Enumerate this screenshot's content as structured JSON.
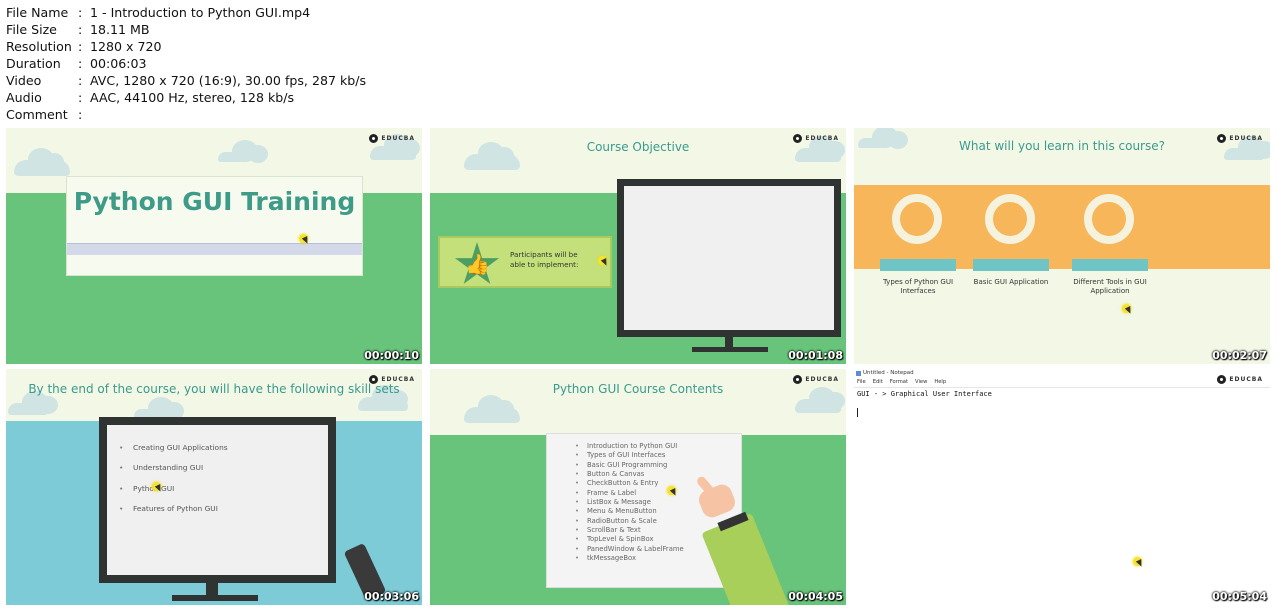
{
  "file_info": [
    {
      "key": "File Name",
      "value": "1 - Introduction to Python GUI.mp4"
    },
    {
      "key": "File Size",
      "value": "18.11 MB"
    },
    {
      "key": "Resolution",
      "value": "1280 x 720"
    },
    {
      "key": "Duration",
      "value": "00:06:03"
    },
    {
      "key": "Video",
      "value": "AVC, 1280 x 720 (16:9), 30.00 fps, 287 kb/s"
    },
    {
      "key": "Audio",
      "value": "AAC, 44100 Hz, stereo, 128 kb/s"
    },
    {
      "key": "Comment",
      "value": ""
    }
  ],
  "separator": ":",
  "logo_text": "EDUCBA",
  "thumbs": [
    {
      "timestamp": "00:00:10",
      "title": "Python GUI Training"
    },
    {
      "timestamp": "00:01:08",
      "title": "Course Objective",
      "banner": "Participants will be able to implement:"
    },
    {
      "timestamp": "00:02:07",
      "title": "What will you learn in this course?",
      "items": [
        "Types of Python GUI Interfaces",
        "Basic GUI Application",
        "Different Tools in GUI Application"
      ]
    },
    {
      "timestamp": "00:03:06",
      "title": "By the end of the course, you will have the following skill sets",
      "items": [
        "Creating GUI Applications",
        "Understanding GUI",
        "Python GUI",
        "Features of Python GUI"
      ]
    },
    {
      "timestamp": "00:04:05",
      "title": "Python GUI Course Contents",
      "items": [
        "Introduction to Python GUI",
        "Types of GUI Interfaces",
        "Basic GUI Programming",
        "Button & Canvas",
        "CheckButton & Entry",
        "Frame & Label",
        "ListBox & Message",
        "Menu & MenuButton",
        "RadioButton & Scale",
        "ScrollBar & Text",
        "TopLevel & SpinBox",
        "PanedWindow & LabelFrame",
        "tkMessageBox"
      ]
    },
    {
      "timestamp": "00:05:04",
      "window_title": "Untitled - Notepad",
      "menu": [
        "File",
        "Edit",
        "Format",
        "View",
        "Help"
      ],
      "text": "GUI - > Graphical User Interface"
    }
  ],
  "colors": {
    "ground_green": "#67c47a",
    "sky": "#f3f8e6",
    "orange_band": "#f8b65a",
    "teal_title": "#3a9a8e",
    "blue_ground": "#7ccbd6"
  }
}
